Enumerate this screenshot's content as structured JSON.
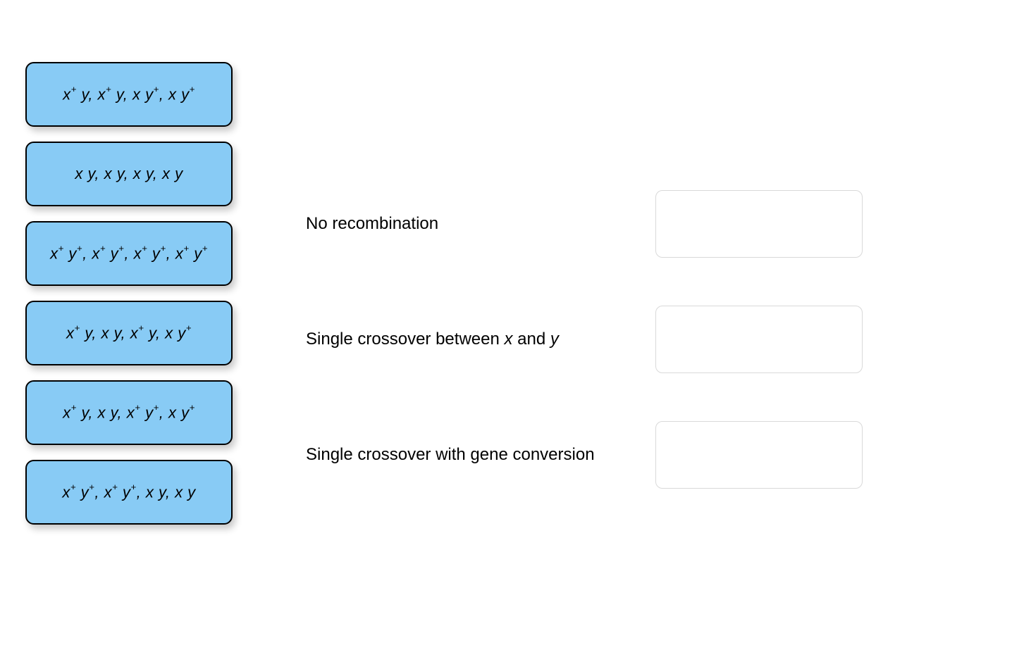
{
  "draggables": [
    {
      "id": "tile-0",
      "genotypes": [
        {
          "x": "+",
          "y": ""
        },
        {
          "x": "+",
          "y": ""
        },
        {
          "x": "",
          "y": "+"
        },
        {
          "x": "",
          "y": "+"
        }
      ]
    },
    {
      "id": "tile-1",
      "genotypes": [
        {
          "x": "",
          "y": ""
        },
        {
          "x": "",
          "y": ""
        },
        {
          "x": "",
          "y": ""
        },
        {
          "x": "",
          "y": ""
        }
      ]
    },
    {
      "id": "tile-2",
      "genotypes": [
        {
          "x": "+",
          "y": "+"
        },
        {
          "x": "+",
          "y": "+"
        },
        {
          "x": "+",
          "y": "+"
        },
        {
          "x": "+",
          "y": "+"
        }
      ]
    },
    {
      "id": "tile-3",
      "genotypes": [
        {
          "x": "+",
          "y": ""
        },
        {
          "x": "",
          "y": ""
        },
        {
          "x": "+",
          "y": ""
        },
        {
          "x": "",
          "y": "+"
        }
      ]
    },
    {
      "id": "tile-4",
      "genotypes": [
        {
          "x": "+",
          "y": ""
        },
        {
          "x": "",
          "y": ""
        },
        {
          "x": "+",
          "y": "+"
        },
        {
          "x": "",
          "y": "+"
        }
      ]
    },
    {
      "id": "tile-5",
      "genotypes": [
        {
          "x": "+",
          "y": "+"
        },
        {
          "x": "+",
          "y": "+"
        },
        {
          "x": "",
          "y": ""
        },
        {
          "x": "",
          "y": ""
        }
      ]
    }
  ],
  "targets": [
    {
      "id": "target-0",
      "label_plain": "No recombination"
    },
    {
      "id": "target-1",
      "label_parts": [
        "Single crossover between ",
        {
          "i": "x"
        },
        " and ",
        {
          "i": "y"
        }
      ]
    },
    {
      "id": "target-2",
      "label_plain": "Single crossover with gene conversion"
    }
  ]
}
